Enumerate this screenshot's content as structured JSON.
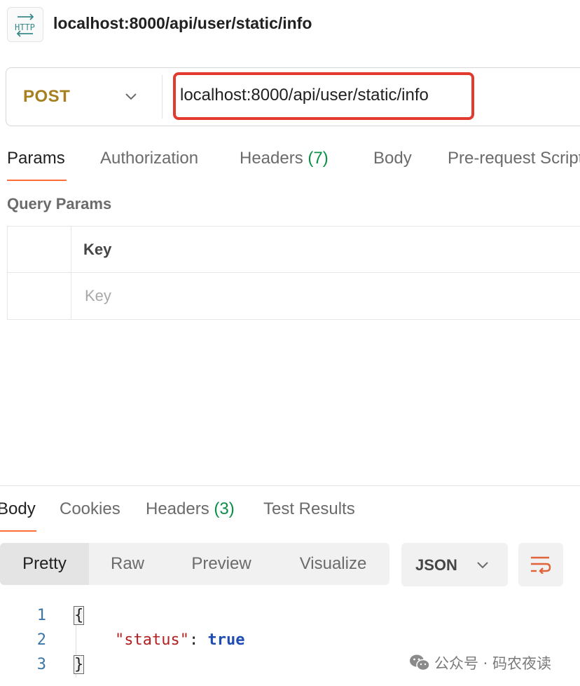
{
  "tab": {
    "icon": "http-icon",
    "icon_text": "HTTP",
    "title": "localhost:8000/api/user/static/info"
  },
  "request": {
    "method": "POST",
    "url": "localhost:8000/api/user/static/info",
    "highlight_color": "#e23a2e"
  },
  "request_tabs": [
    {
      "label": "Params",
      "active": true
    },
    {
      "label": "Authorization",
      "active": false
    },
    {
      "label": "Headers",
      "count": "(7)",
      "active": false
    },
    {
      "label": "Body",
      "active": false
    },
    {
      "label": "Pre-request Script",
      "active": false
    }
  ],
  "query_params": {
    "title": "Query Params",
    "header_key": "Key",
    "key_placeholder": "Key"
  },
  "response_tabs": [
    {
      "label": "Body",
      "active": true
    },
    {
      "label": "Cookies",
      "active": false
    },
    {
      "label": "Headers",
      "count": "(3)",
      "active": false
    },
    {
      "label": "Test Results",
      "active": false
    }
  ],
  "view_modes": [
    {
      "label": "Pretty",
      "active": true
    },
    {
      "label": "Raw",
      "active": false
    },
    {
      "label": "Preview",
      "active": false
    },
    {
      "label": "Visualize",
      "active": false
    }
  ],
  "format": {
    "label": "JSON",
    "icon": "chevron-down-icon"
  },
  "wrap_icon": "wrap-lines-icon",
  "code": {
    "line_numbers": [
      "1",
      "2",
      "3"
    ],
    "open_brace": "{",
    "key": "\"status\"",
    "colon": ": ",
    "value": "true",
    "close_brace": "}"
  },
  "watermark": {
    "icon": "wechat-icon",
    "text": "公众号 · 码农夜读"
  },
  "colors": {
    "method": "#a6801f",
    "active_tab_underline": "#ff6c37",
    "count": "#0a8f47",
    "json_key": "#b22020",
    "json_bool": "#1f4db3"
  }
}
